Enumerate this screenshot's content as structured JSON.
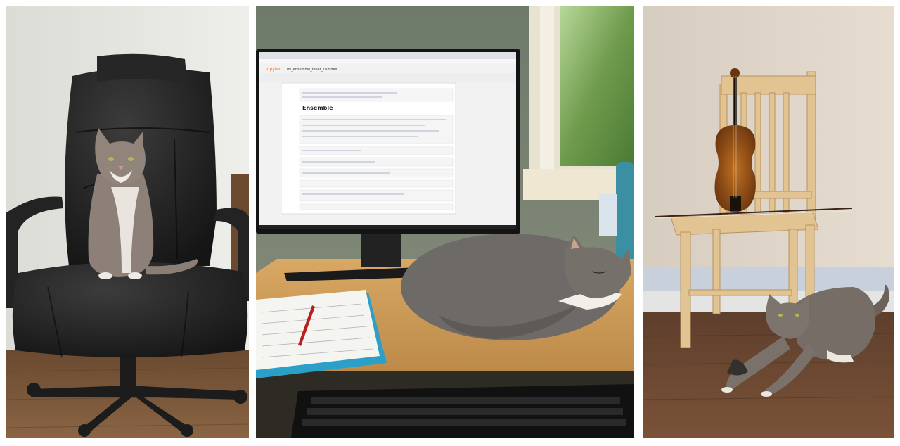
{
  "collage": {
    "background": "#ffffff",
    "photos": [
      {
        "subject": "tabby-cat-sitting-on-black-leather-office-chair"
      },
      {
        "subject": "cat-sleeping-on-desk-beside-monitor-with-jupyter-notebook",
        "screen": {
          "app_name": "jupyter",
          "notebook_title": "ml_ensemble_fever_10mdex",
          "heading": "Ensemble"
        }
      },
      {
        "subject": "tabby-cat-playing-on-wood-floor-below-chair-with-violin-and-bow"
      }
    ]
  }
}
